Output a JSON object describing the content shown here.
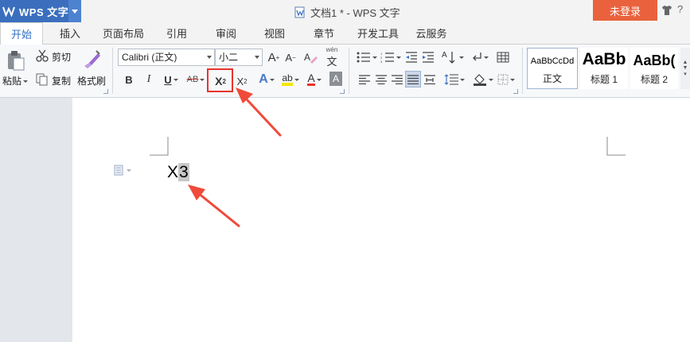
{
  "titlebar": {
    "app_name": "WPS 文字",
    "doc_title": "文档1 * - WPS 文字",
    "login_label": "未登录"
  },
  "tabs": [
    {
      "label": "开始",
      "active": true
    },
    {
      "label": "插入"
    },
    {
      "label": "页面布局"
    },
    {
      "label": "引用"
    },
    {
      "label": "审阅"
    },
    {
      "label": "视图"
    },
    {
      "label": "章节"
    },
    {
      "label": "开发工具"
    },
    {
      "label": "云服务"
    }
  ],
  "clipboard": {
    "paste_label": "粘贴",
    "cut_label": "剪切",
    "copy_label": "复制",
    "format_painter_label": "格式刷"
  },
  "font": {
    "family": "Calibri (正文)",
    "size": "小二",
    "bold": "B",
    "italic": "I",
    "underline": "U",
    "strike": "AB",
    "superscript": "X",
    "superscript_mark": "2",
    "subscript": "X",
    "subscript_mark": "2",
    "text_effect": "A",
    "highlight": "ab",
    "font_color": "A",
    "char_shading": "A",
    "grow": "A",
    "shrink": "A",
    "phonetic_top": "wén",
    "phonetic_char": "文"
  },
  "styles": [
    {
      "preview": "AaBbCcDd",
      "name": "正文"
    },
    {
      "preview": "AaBb",
      "name": "标题 1"
    },
    {
      "preview": "AaBb(",
      "name": "标题 2"
    }
  ],
  "document": {
    "text": "X",
    "selected_text": "3"
  },
  "colors": {
    "brand_blue": "#3b6fbe",
    "login_orange": "#e9623d",
    "highlight_red": "#e8342b",
    "active_tab_text": "#2e6fc7"
  }
}
